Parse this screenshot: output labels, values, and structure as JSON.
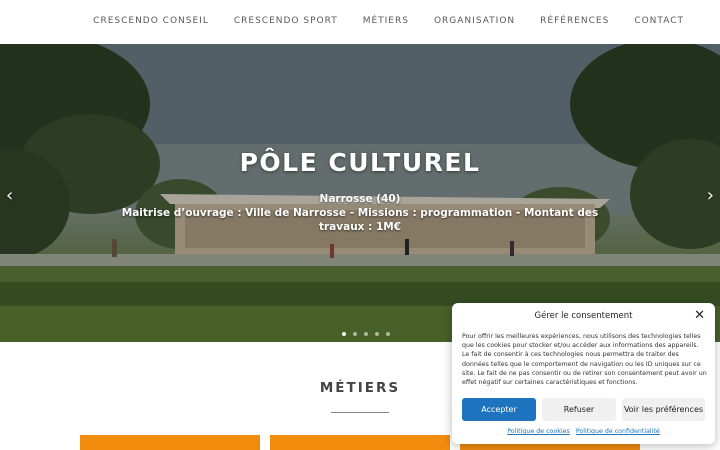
{
  "nav": {
    "items": [
      "CRESCENDO CONSEIL",
      "CRESCENDO SPORT",
      "MÉTIERS",
      "ORGANISATION",
      "RÉFÉRENCES",
      "CONTACT"
    ]
  },
  "hero": {
    "title": "PÔLE CULTUREL",
    "location": "Narrosse (40)",
    "line1": "Maitrise d’ouvrage : Ville de Narrosse - Missions : programmation - Montant des",
    "line2": "travaux : 1M€",
    "prev_icon": "chevron-left-icon",
    "next_icon": "chevron-right-icon",
    "slides_total": 5,
    "active_slide": 1
  },
  "section": {
    "title": "MÉTIERS"
  },
  "consent": {
    "title": "Gérer le consentement",
    "text": "Pour offrir les meilleures expériences, nous utilisons des technologies telles que les cookies pour stocker et/ou accéder aux informations des appareils. Le fait de consentir à ces technologies nous permettra de traiter des données telles que le comportement de navigation ou les ID uniques sur ce site. Le fait de ne pas consentir ou de retirer son consentement peut avoir un effet négatif sur certaines caractéristiques et fonctions.",
    "accept_label": "Accepter",
    "refuse_label": "Refuser",
    "prefs_label": "Voir les préférences",
    "cookie_policy_label": "Politique de cookies",
    "privacy_policy_label": "Politique de confidentialité"
  },
  "colors": {
    "accent_orange": "#f28c0f",
    "button_blue": "#1e73be"
  }
}
